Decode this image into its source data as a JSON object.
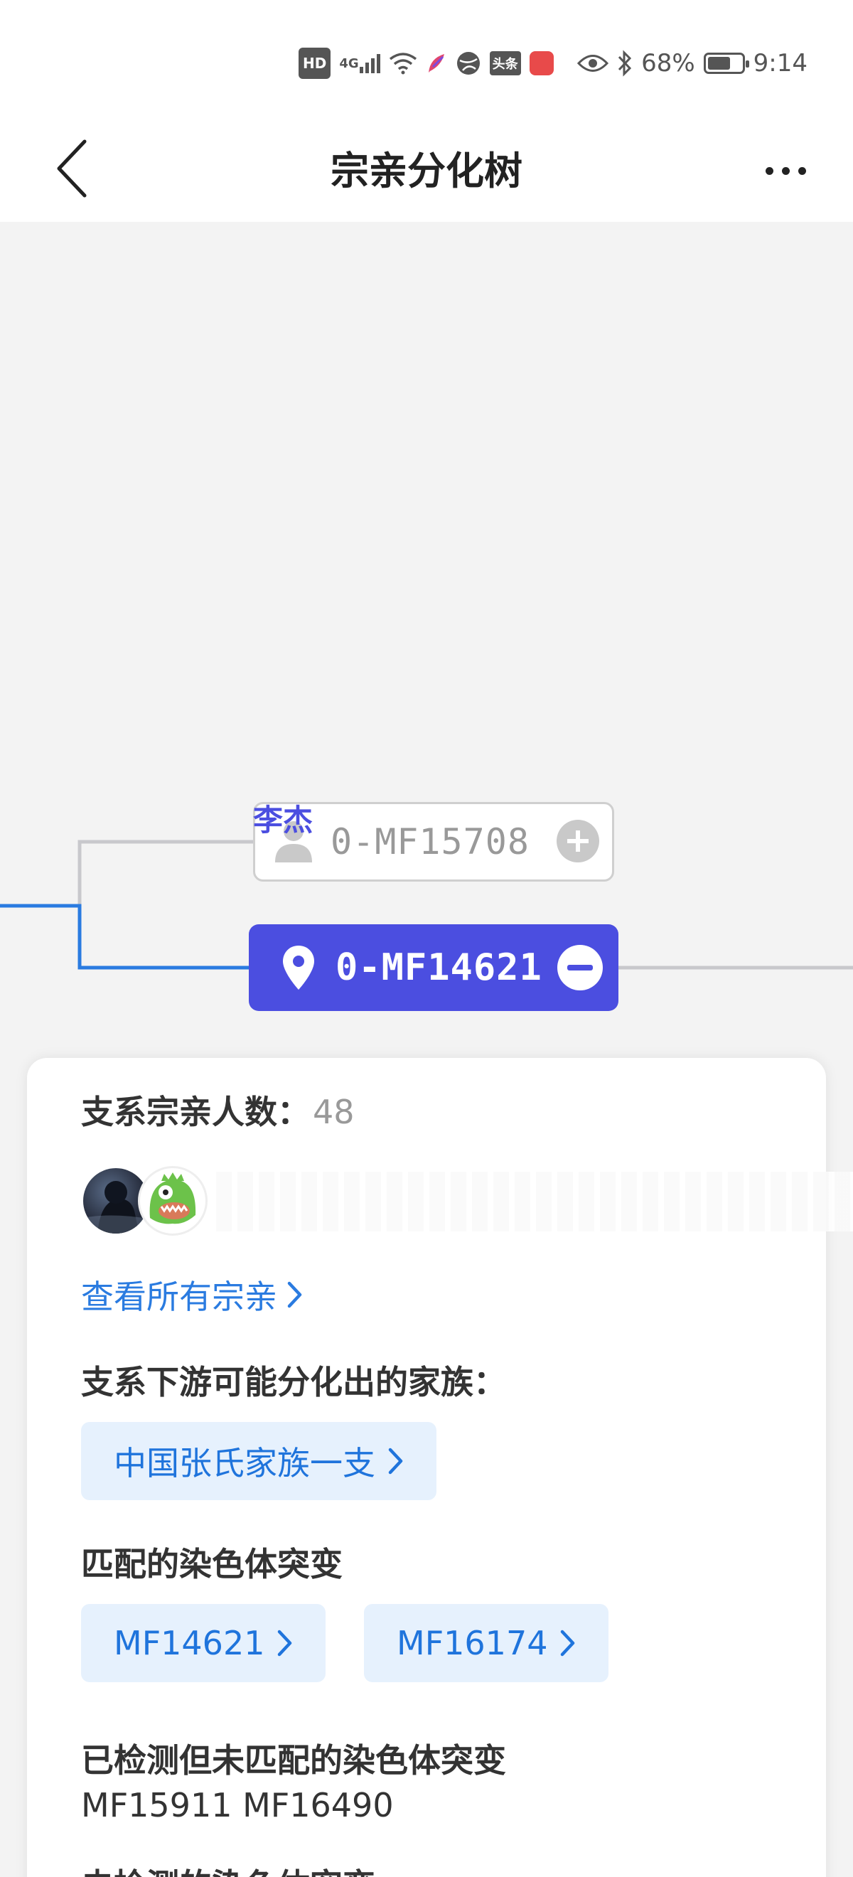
{
  "status_bar": {
    "hd": "HD",
    "network": "4G",
    "app_toutiao": "头条",
    "battery_percent": "68%",
    "battery_level": 0.68,
    "time": "9:14"
  },
  "header": {
    "title": "宗亲分化树"
  },
  "tree": {
    "ghost_node_label": "0-MF15708",
    "active_node_label": "0-MF14621",
    "active_node_person": "李杰",
    "accent_color": "#4b4ee0",
    "line_color_active": "#2a7be0",
    "line_color_inactive": "#c8c8cc"
  },
  "card": {
    "branch_count_label": "支系宗亲人数：",
    "branch_count_value": "48",
    "view_all_link": "查看所有宗亲",
    "downstream_title": "支系下游可能分化出的家族：",
    "downstream_families": [
      "中国张氏家族一支"
    ],
    "matched_title": "匹配的染色体突变",
    "matched_mutations": [
      "MF14621",
      "MF16174"
    ],
    "unmatched_title": "已检测但未匹配的染色体突变",
    "unmatched_values": "MF15911 MF16490",
    "next_title_partial": "未检测的染色体突变"
  }
}
